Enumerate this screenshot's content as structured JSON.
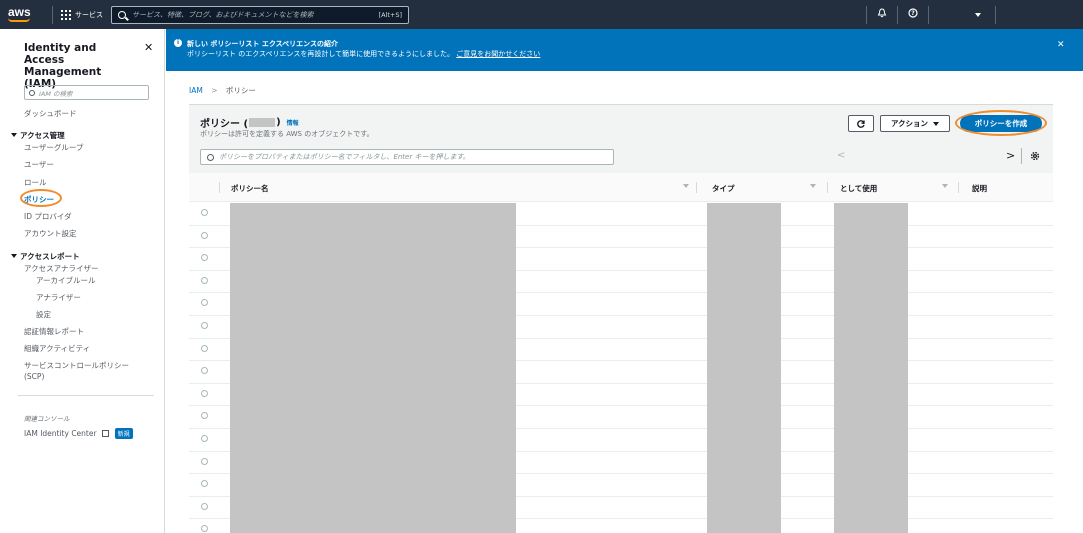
{
  "topbar": {
    "logo_text": "aws",
    "services_label": "サービス",
    "search_placeholder": "サービス、特徴、ブログ、およびドキュメントなどを検索",
    "search_shortcut": "[Alt+S]"
  },
  "sidebar": {
    "title": "Identity and Access Management (IAM)",
    "search_placeholder": "IAM の検索",
    "dashboard": "ダッシュボード",
    "access_management_header": "アクセス管理",
    "access_management_items": [
      "ユーザーグループ",
      "ユーザー",
      "ロール",
      "ポリシー",
      "ID プロバイダ",
      "アカウント設定"
    ],
    "access_reports_header": "アクセスレポート",
    "access_analyzer": "アクセスアナライザー",
    "analyzer_subitems": [
      "アーカイブルール",
      "アナライザー",
      "設定"
    ],
    "credential_report": "認証情報レポート",
    "org_activity": "組織アクティビティ",
    "scp": "サービスコントロールポリシー (SCP)",
    "related_consoles": "関連コンソール",
    "identity_center": "IAM Identity Center",
    "new_badge": "新規"
  },
  "banner": {
    "title": "新しい ポリシーリスト エクスペリエンスの紹介",
    "text": "ポリシーリスト のエクスペリエンスを再設計して簡単に使用できるようにしました。",
    "link": "ご意見をお聞かせください"
  },
  "breadcrumb": {
    "root": "IAM",
    "current": "ポリシー"
  },
  "panel": {
    "title": "ポリシー (",
    "title_close": ")",
    "info": "情報",
    "subtitle": "ポリシーは許可を定義する AWS のオブジェクトです。",
    "filter_placeholder": "ポリシーをプロパティまたはポリシー名でフィルタし、Enter キーを押します。",
    "actions_label": "アクション",
    "create_label": "ポリシーを作成",
    "prev": "<",
    "next": ">"
  },
  "table": {
    "columns": [
      "ポリシー名",
      "タイプ",
      "として使用",
      "説明"
    ],
    "row_count": 15
  },
  "colors": {
    "topbar": "#232f3e",
    "accent": "#0073bb",
    "highlight": "#f08c2e",
    "redaction": "#c4c4c4"
  },
  "icons": [
    "grid-icon",
    "search-icon",
    "bell-icon",
    "help-icon",
    "close-icon",
    "info-icon",
    "refresh-icon",
    "settings-icon",
    "external-link-icon"
  ]
}
